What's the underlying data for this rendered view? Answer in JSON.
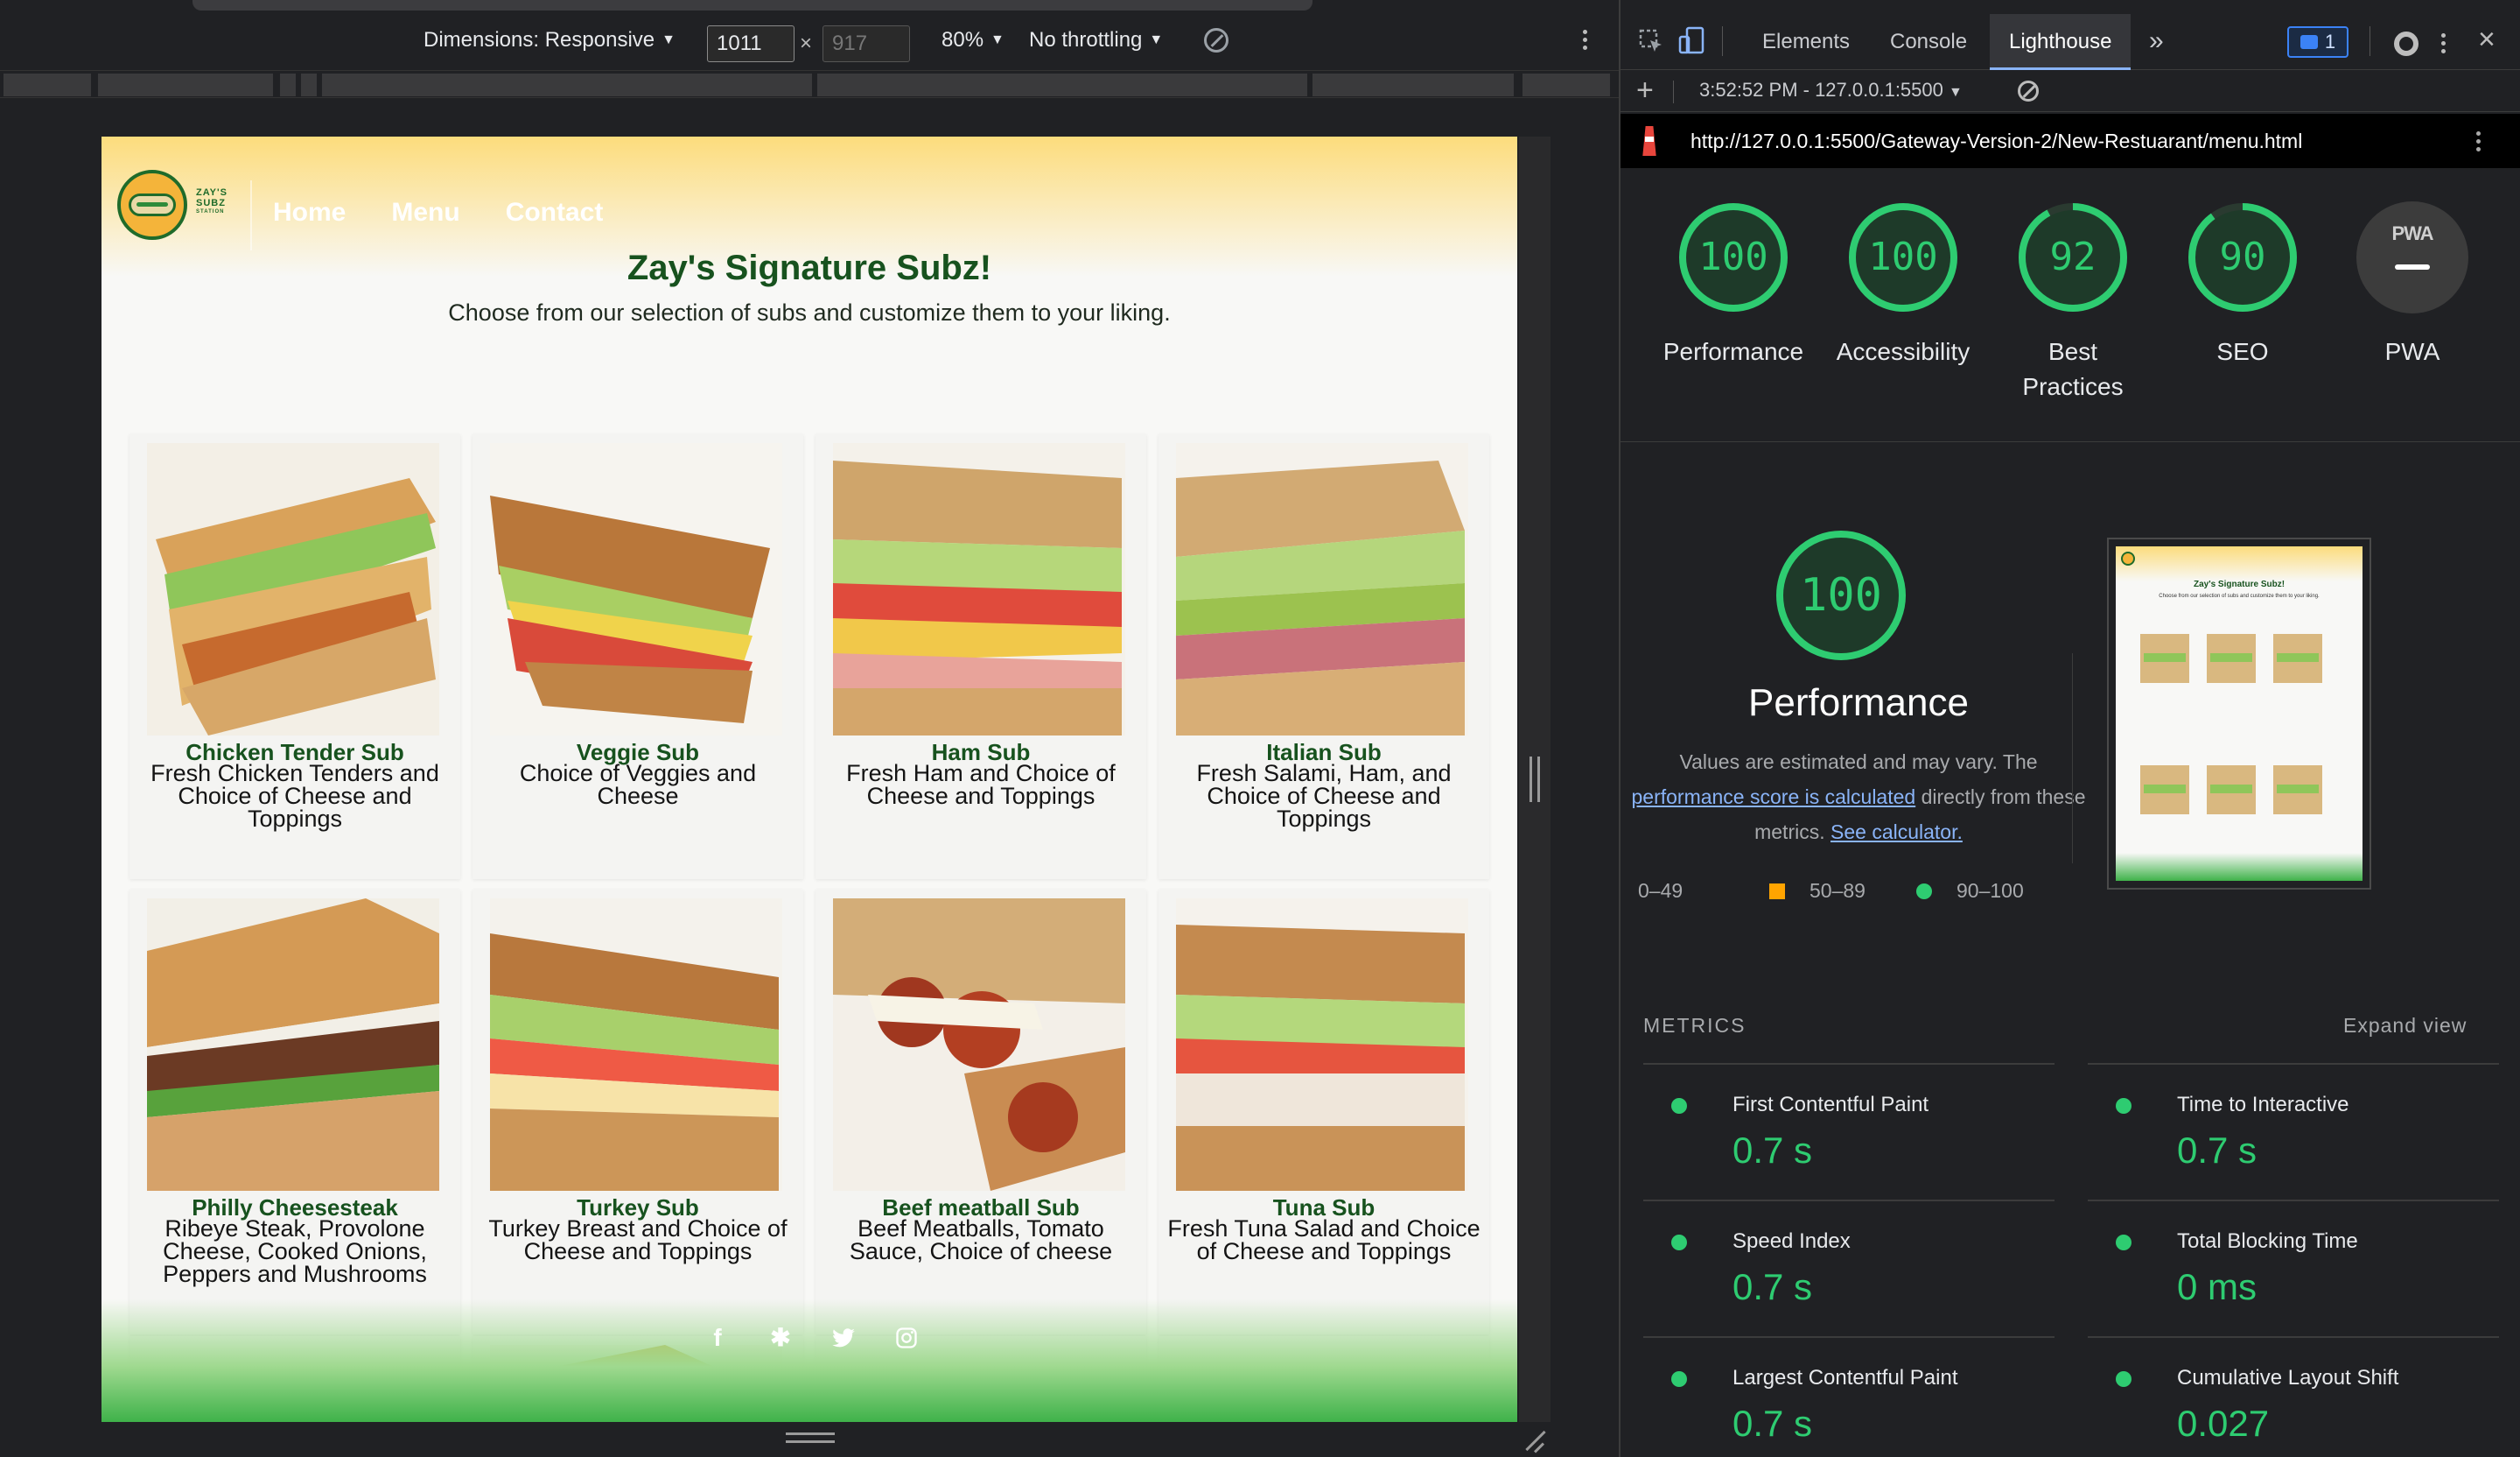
{
  "device_toolbar": {
    "dimensions_label": "Dimensions: Responsive",
    "width_value": "1011",
    "height_value": "917",
    "times": "×",
    "zoom": "80%",
    "throttling": "No throttling"
  },
  "page": {
    "nav": [
      "Home",
      "Menu",
      "Contact"
    ],
    "logo_text": [
      "ZAY'S",
      "SUBZ",
      "STATION"
    ],
    "title": "Zay's Signature Subz!",
    "subtitle": "Choose from our selection of subs and customize them to your liking.",
    "subs": [
      {
        "name": "Chicken Tender Sub",
        "desc": "Fresh Chicken Tenders and Choice of Cheese and Toppings"
      },
      {
        "name": "Veggie Sub",
        "desc": "Choice of Veggies and Cheese"
      },
      {
        "name": "Ham Sub",
        "desc": "Fresh Ham and Choice of Cheese and Toppings"
      },
      {
        "name": "Italian Sub",
        "desc": "Fresh Salami, Ham, and Choice of Cheese and Toppings"
      },
      {
        "name": "Philly Cheesesteak",
        "desc": "Ribeye Steak, Provolone Cheese, Cooked Onions, Peppers and Mushrooms"
      },
      {
        "name": "Turkey Sub",
        "desc": "Turkey Breast and Choice of Cheese and Toppings"
      },
      {
        "name": "Beef meatball Sub",
        "desc": "Beef Meatballs, Tomato Sauce, Choice of cheese"
      },
      {
        "name": "Tuna Sub",
        "desc": "Fresh Tuna Salad and Choice of Cheese and Toppings"
      }
    ],
    "socials": [
      "facebook-icon",
      "yelp-icon",
      "twitter-icon",
      "instagram-icon"
    ]
  },
  "devtools": {
    "tabs": [
      "Elements",
      "Console",
      "Lighthouse"
    ],
    "active_tab": "Lighthouse",
    "message_count": "1",
    "report_selector": "3:52:52 PM - 127.0.0.1:5500",
    "url": "http://127.0.0.1:5500/Gateway-Version-2/New-Restuarant/menu.html"
  },
  "lighthouse": {
    "scores": [
      {
        "label": "Performance",
        "value": "100",
        "score": 100
      },
      {
        "label": "Accessibility",
        "value": "100",
        "score": 100
      },
      {
        "label": "Best Practices",
        "value": "92",
        "score": 92
      },
      {
        "label": "SEO",
        "value": "90",
        "score": 90
      }
    ],
    "pwa": {
      "label": "PWA",
      "badge": "PWA"
    },
    "perf": {
      "score": "100",
      "title": "Performance",
      "desc_1": "Values are estimated and may vary. The",
      "link_1": "performance score is calculated",
      "desc_2": "directly from these metrics.",
      "link_2": "See calculator."
    },
    "legend": [
      "0–49",
      "50–89",
      "90–100"
    ],
    "thumb": {
      "title": "Zay's Signature Subz!",
      "subtitle": "Choose from our selection of subs and customize them to your liking."
    },
    "metrics_header": "METRICS",
    "expand_label": "Expand view",
    "metrics": [
      {
        "name": "First Contentful Paint",
        "value": "0.7 s"
      },
      {
        "name": "Time to Interactive",
        "value": "0.7 s"
      },
      {
        "name": "Speed Index",
        "value": "0.7 s"
      },
      {
        "name": "Total Blocking Time",
        "value": "0 ms"
      },
      {
        "name": "Largest Contentful Paint",
        "value": "0.7 s"
      },
      {
        "name": "Cumulative Layout Shift",
        "value": "0.027"
      }
    ]
  },
  "colors": {
    "pass": "#2ecc71",
    "average": "#ffa400",
    "fail": "#ff4e42",
    "brand_green": "#17521e",
    "header_yellow": "#fcdc7c"
  }
}
